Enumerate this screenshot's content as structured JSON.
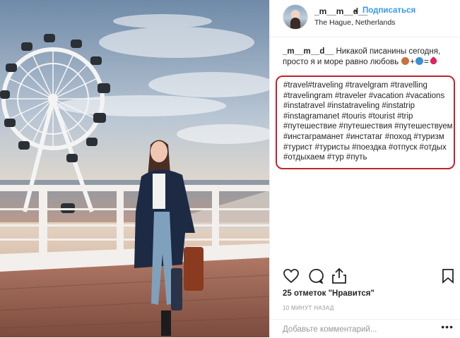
{
  "post": {
    "username": "_m__m__d__",
    "separator": "•",
    "follow_label": "Подписаться",
    "location": "The Hague, Netherlands",
    "caption_user": "_m__m__d__",
    "caption_text": "Никакой писанины сегодня, просто я и море равно любовь",
    "hashtags": "#travel#traveling #travelgram #travelling\n#travelingram #traveler #vacation #vacations\n#instatravel #instatraveling #instatrip\n#instagramanet #touris #tourist #trip\n#путешествие #путешествия #путешествуем\n#инстаграманет #инстатаг #поход #туризм\n#турист #туристы #поездка #отпуск #отдых\n#отдыхаем #тур #путь",
    "likes": "25 отметок \"Нравится\"",
    "time": "10 минут назад",
    "comment_placeholder": "Добавьте комментарий...",
    "more": "•••"
  },
  "icons": {
    "like": "heart-icon",
    "comment": "comment-icon",
    "share": "share-icon",
    "save": "bookmark-icon"
  },
  "colors": {
    "accent": "#3897f0",
    "highlight_border": "#c0232c",
    "heart": "#e0245e"
  }
}
